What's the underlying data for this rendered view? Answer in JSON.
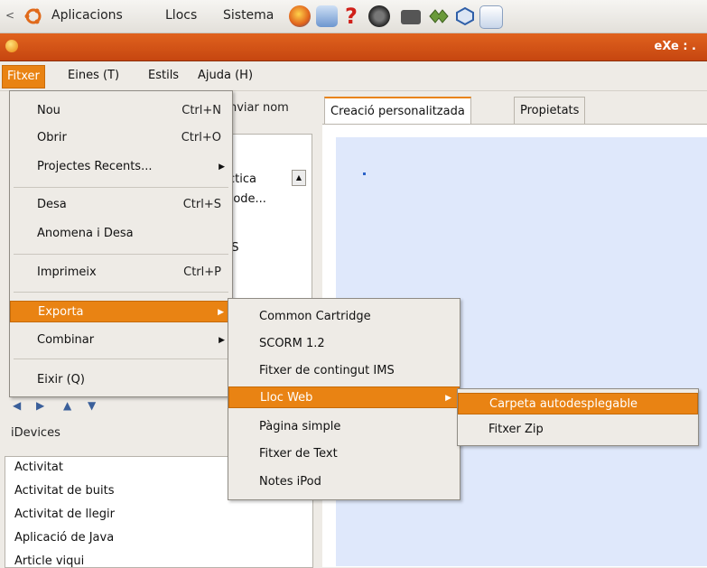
{
  "panel": {
    "menus": [
      "Aplicacions",
      "Llocs",
      "Sistema"
    ]
  },
  "window": {
    "title": "eXe : ."
  },
  "menubar": {
    "items": [
      "Fitxer",
      "Eines (T)",
      "Estils",
      "Ajuda (H)"
    ]
  },
  "app": {
    "rename_button": "anviar nom",
    "outline_lines": [
      "àctica",
      "utode...",
      "MS"
    ],
    "idevices_title": "iDevices",
    "idevices": [
      "Activitat",
      "Activitat de buits",
      "Activitat de llegir",
      "Aplicació de Java",
      "Article viqui"
    ]
  },
  "tabs": [
    "Creació personalitzada",
    "Propietats"
  ],
  "file_menu": {
    "items": [
      {
        "label": "Nou",
        "accel": "Ctrl+N"
      },
      {
        "label": "Obrir",
        "accel": "Ctrl+O"
      },
      {
        "label": "Projectes Recents...",
        "accel": ""
      },
      {
        "label": "Desa",
        "accel": "Ctrl+S"
      },
      {
        "label": "Anomena i Desa",
        "accel": ""
      },
      {
        "label": "Imprimeix",
        "accel": "Ctrl+P"
      },
      {
        "label": "Exporta",
        "accel": ""
      },
      {
        "label": "Combinar",
        "accel": ""
      },
      {
        "label": "Eixir (Q)",
        "accel": ""
      }
    ]
  },
  "export_menu": {
    "items": [
      "Common Cartridge",
      "SCORM 1.2",
      "Fitxer de contingut IMS",
      "Lloc Web",
      "Pàgina simple",
      "Fitxer de Text",
      "Notes iPod"
    ]
  },
  "web_menu": {
    "items": [
      "Carpeta autodesplegable",
      "Fitxer Zip"
    ]
  },
  "colors": {
    "accent": "#e98313",
    "titlebar": "#d35a18",
    "canvas": "#dfe8fb"
  }
}
